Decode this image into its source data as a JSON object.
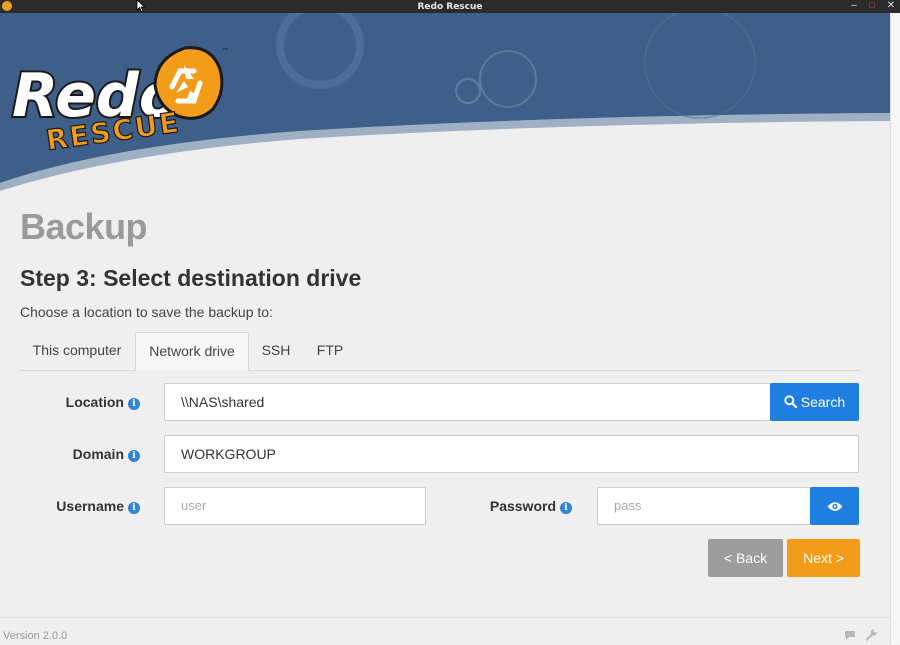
{
  "window": {
    "title": "Redo Rescue"
  },
  "logo": {
    "word": "Redo",
    "sub": "RESCUE",
    "tm": "™"
  },
  "page": {
    "title": "Backup",
    "step_title": "Step 3: Select destination drive",
    "instructions": "Choose a location to save the backup to:"
  },
  "tabs": [
    {
      "label": "This computer",
      "active": false
    },
    {
      "label": "Network drive",
      "active": true
    },
    {
      "label": "SSH",
      "active": false
    },
    {
      "label": "FTP",
      "active": false
    }
  ],
  "form": {
    "location": {
      "label": "Location",
      "value": "\\\\NAS\\shared"
    },
    "domain": {
      "label": "Domain",
      "value": "WORKGROUP"
    },
    "username": {
      "label": "Username",
      "placeholder": "user"
    },
    "password": {
      "label": "Password",
      "placeholder": "pass"
    },
    "search_label": "Search"
  },
  "nav": {
    "back_label": "< Back",
    "next_label": "Next >"
  },
  "footer": {
    "version": "Version 2.0.0"
  },
  "colors": {
    "header_blue": "#3d5f8a",
    "accent_orange": "#f39c1a",
    "button_blue": "#1f7fe0",
    "back_gray": "#9d9d9d"
  },
  "icons": {
    "search": "search-icon",
    "eye": "eye-icon",
    "info": "info-icon",
    "recycle": "recycle-icon"
  }
}
